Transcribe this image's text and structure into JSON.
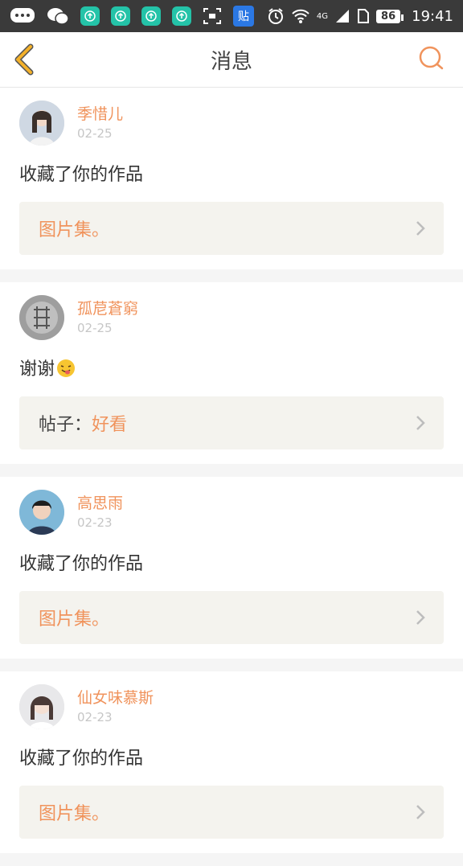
{
  "status_bar": {
    "tie_label": "贴",
    "network": "4G",
    "battery": "86",
    "time": "19:41"
  },
  "header": {
    "title": "消息"
  },
  "notifications": [
    {
      "username": "季惜儿",
      "date": "02-25",
      "comment": "收藏了你的作品",
      "ref_prefix": "",
      "ref_title": "图片集。"
    },
    {
      "username": "孤苨蒼窮",
      "date": "02-25",
      "comment": "谢谢",
      "ref_prefix": "帖子：",
      "ref_title": "好看"
    },
    {
      "username": "高思雨",
      "date": "02-23",
      "comment": "收藏了你的作品",
      "ref_prefix": "",
      "ref_title": "图片集。"
    },
    {
      "username": "仙女味慕斯",
      "date": "02-23",
      "comment": "收藏了你的作品",
      "ref_prefix": "",
      "ref_title": "图片集。"
    }
  ],
  "colors": {
    "accent": "#f0935c",
    "back_arrow": "#f4b12a",
    "ref_bg": "#f4f3ee"
  }
}
